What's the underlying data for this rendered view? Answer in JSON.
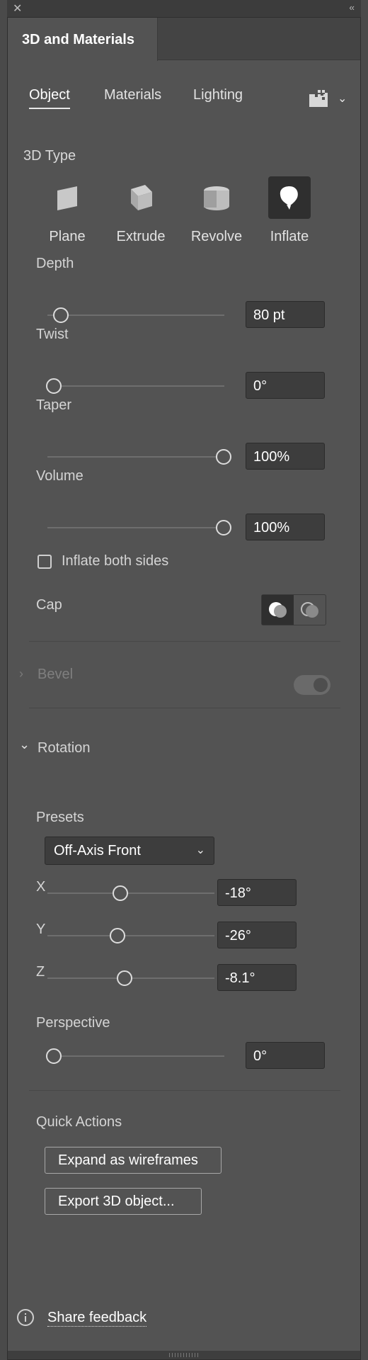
{
  "window": {
    "close_glyph": "✕",
    "collapse_glyph": "‹‹"
  },
  "panel": {
    "title": "3D and Materials"
  },
  "subtabs": [
    "Object",
    "Materials",
    "Lighting"
  ],
  "section_3dtype": {
    "heading": "3D Type",
    "types": [
      {
        "label": "Plane",
        "icon": "plane-icon",
        "selected": false
      },
      {
        "label": "Extrude",
        "icon": "extrude-icon",
        "selected": false
      },
      {
        "label": "Revolve",
        "icon": "revolve-icon",
        "selected": false
      },
      {
        "label": "Inflate",
        "icon": "inflate-icon",
        "selected": true
      }
    ]
  },
  "controls": {
    "depth": {
      "label": "Depth",
      "value": "80 pt",
      "level": 0.1
    },
    "twist": {
      "label": "Twist",
      "value": "0°",
      "level": 0.0
    },
    "taper": {
      "label": "Taper",
      "value": "100%",
      "level": 1.0
    },
    "volume": {
      "label": "Volume",
      "value": "100%",
      "level": 1.0
    },
    "inflate_both_sides": {
      "label": "Inflate both sides",
      "checked": false
    },
    "cap": {
      "label": "Cap"
    }
  },
  "bevel": {
    "label": "Bevel",
    "enabled": false
  },
  "rotation": {
    "label": "Rotation",
    "presets_label": "Presets",
    "preset_value": "Off-Axis Front",
    "axes": [
      {
        "axis": "X",
        "value": "-18°",
        "level": 0.45
      },
      {
        "axis": "Y",
        "value": "-26°",
        "level": 0.43
      },
      {
        "axis": "Z",
        "value": "-8.1°",
        "level": 0.48
      }
    ],
    "perspective": {
      "label": "Perspective",
      "value": "0°",
      "level": 0.0
    }
  },
  "quick_actions": {
    "heading": "Quick Actions",
    "expand_label": "Expand as wireframes",
    "export_label": "Export 3D object..."
  },
  "footer": {
    "feedback_label": "Share feedback"
  },
  "colors": {
    "panel": "#535353",
    "selected": "#2f2f2f",
    "text": "#e8e8e8"
  }
}
